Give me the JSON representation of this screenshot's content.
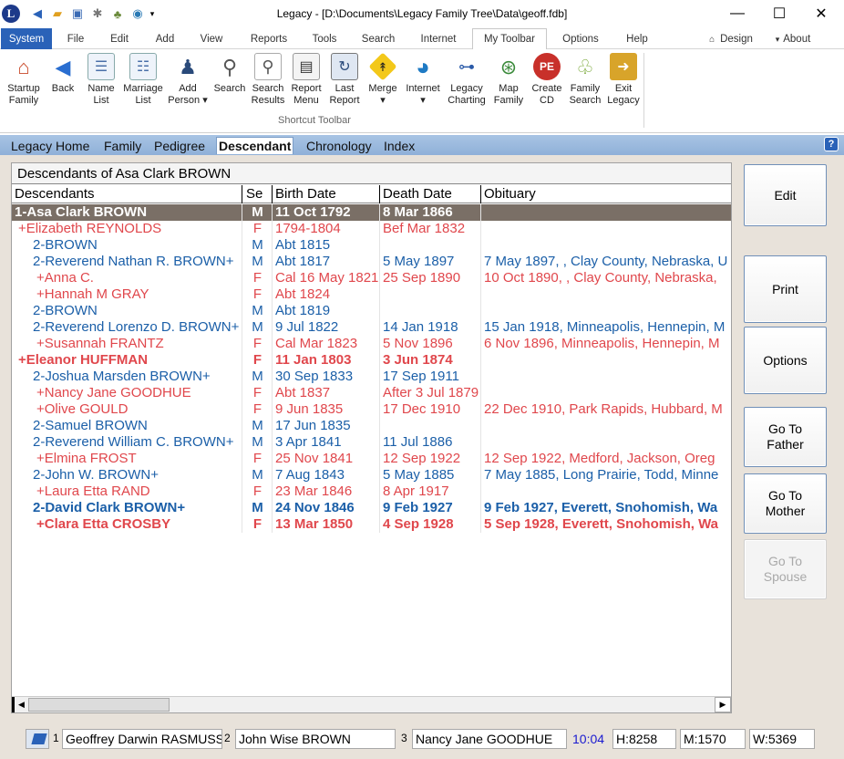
{
  "window": {
    "title": "Legacy - [D:\\Documents\\Legacy Family Tree\\Data\\geoff.fdb]",
    "controls": {
      "minimize": "—",
      "maximize": "☐",
      "close": "✕"
    }
  },
  "quick_access": {
    "logo_letter": "L",
    "icons": [
      "back-arrow-icon",
      "open-folder-icon",
      "save-icon",
      "tools-icon",
      "tree-icon",
      "globe-icon",
      "customize-icon"
    ]
  },
  "menu": {
    "tabs": [
      "System",
      "File",
      "Edit",
      "Add",
      "View",
      "Reports",
      "Tools",
      "Search",
      "Internet",
      "My Toolbar",
      "Options",
      "Help"
    ],
    "active": "My Toolbar",
    "right": {
      "design": "Design",
      "about": "About"
    }
  },
  "ribbon": {
    "group_label": "Shortcut Toolbar",
    "buttons": [
      {
        "l1": "Startup",
        "l2": "Family",
        "icon": "house-icon"
      },
      {
        "l1": "Back",
        "l2": "",
        "icon": "back-arrow-icon"
      },
      {
        "l1": "Name",
        "l2": "List",
        "icon": "name-list-icon"
      },
      {
        "l1": "Marriage",
        "l2": "List",
        "icon": "marriage-list-icon"
      },
      {
        "l1": "Add",
        "l2": "Person ▾",
        "icon": "add-person-icon"
      },
      {
        "l1": "Search",
        "l2": "",
        "icon": "magnifier-icon"
      },
      {
        "l1": "Search",
        "l2": "Results",
        "icon": "search-results-icon"
      },
      {
        "l1": "Report",
        "l2": "Menu",
        "icon": "report-menu-icon"
      },
      {
        "l1": "Last",
        "l2": "Report",
        "icon": "last-report-icon"
      },
      {
        "l1": "Merge",
        "l2": "▾",
        "icon": "merge-sign-icon"
      },
      {
        "l1": "Internet",
        "l2": "▾",
        "icon": "globe-icon"
      },
      {
        "l1": "Legacy",
        "l2": "Charting",
        "icon": "charting-icon"
      },
      {
        "l1": "Map",
        "l2": "Family",
        "icon": "map-icon"
      },
      {
        "l1": "Create",
        "l2": "CD",
        "icon": "cd-icon"
      },
      {
        "l1": "Family",
        "l2": "Search",
        "icon": "family-search-icon"
      },
      {
        "l1": "Exit",
        "l2": "Legacy",
        "icon": "exit-door-icon"
      }
    ]
  },
  "view_tabs": {
    "tabs": [
      "Legacy Home",
      "Family",
      "Pedigree",
      "Descendant",
      "Chronology",
      "Index"
    ],
    "active": "Descendant",
    "help": "?"
  },
  "grid": {
    "title": "Descendants of Asa Clark BROWN",
    "columns": [
      "Descendants",
      "Se",
      "Birth Date",
      "Death Date",
      "Obituary"
    ],
    "rows": [
      {
        "name": "1-Asa Clark BROWN",
        "sex": "M",
        "birth": "11 Oct 1792",
        "death": "8 Mar 1866",
        "obit": "",
        "style": "sel"
      },
      {
        "name": "+Elizabeth REYNOLDS",
        "sex": "F",
        "birth": "1794-1804",
        "death": "Bef Mar 1832",
        "obit": "",
        "style": "f"
      },
      {
        "name": "2-BROWN",
        "sex": "M",
        "birth": "Abt 1815",
        "death": "",
        "obit": "",
        "style": "m"
      },
      {
        "name": "2-Reverend Nathan R. BROWN+",
        "sex": "M",
        "birth": "Abt 1817",
        "death": "5 May 1897",
        "obit": "7 May 1897, , Clay County, Nebraska, U",
        "style": "m"
      },
      {
        "name": "+Anna C.",
        "sex": "F",
        "birth": "Cal 16 May 1821",
        "death": "25 Sep 1890",
        "obit": "10 Oct 1890, , Clay County, Nebraska, ",
        "style": "f"
      },
      {
        "name": "+Hannah M GRAY",
        "sex": "F",
        "birth": "Abt 1824",
        "death": "",
        "obit": "",
        "style": "f"
      },
      {
        "name": "2-BROWN",
        "sex": "M",
        "birth": "Abt 1819",
        "death": "",
        "obit": "",
        "style": "m"
      },
      {
        "name": "2-Reverend Lorenzo D. BROWN+",
        "sex": "M",
        "birth": "9 Jul 1822",
        "death": "14 Jan 1918",
        "obit": "15 Jan 1918, Minneapolis, Hennepin, M",
        "style": "m"
      },
      {
        "name": "+Susannah FRANTZ",
        "sex": "F",
        "birth": "Cal Mar 1823",
        "death": "5 Nov 1896",
        "obit": "6 Nov 1896, Minneapolis, Hennepin, M",
        "style": "f"
      },
      {
        "name": "+Eleanor HUFFMAN",
        "sex": "F",
        "birth": "11 Jan 1803",
        "death": "3 Jun 1874",
        "obit": "",
        "style": "f bold"
      },
      {
        "name": "2-Joshua Marsden BROWN+",
        "sex": "M",
        "birth": "30 Sep 1833",
        "death": "17 Sep 1911",
        "obit": "",
        "style": "m"
      },
      {
        "name": "+Nancy Jane GOODHUE",
        "sex": "F",
        "birth": "Abt 1837",
        "death": "After 3 Jul 1879",
        "obit": "",
        "style": "f"
      },
      {
        "name": "+Olive GOULD",
        "sex": "F",
        "birth": "9 Jun 1835",
        "death": "17 Dec 1910",
        "obit": "22 Dec 1910, Park Rapids, Hubbard, M",
        "style": "f"
      },
      {
        "name": "2-Samuel BROWN",
        "sex": "M",
        "birth": "17 Jun 1835",
        "death": "",
        "obit": "",
        "style": "m"
      },
      {
        "name": "2-Reverend William C. BROWN+",
        "sex": "M",
        "birth": "3 Apr 1841",
        "death": "11 Jul 1886",
        "obit": "",
        "style": "m"
      },
      {
        "name": "+Elmina FROST",
        "sex": "F",
        "birth": "25 Nov 1841",
        "death": "12 Sep 1922",
        "obit": "12 Sep 1922, Medford, Jackson, Oreg",
        "style": "f"
      },
      {
        "name": "2-John W. BROWN+",
        "sex": "M",
        "birth": "7 Aug 1843",
        "death": "5 May 1885",
        "obit": "7 May 1885, Long Prairie, Todd, Minne",
        "style": "m"
      },
      {
        "name": "+Laura Etta RAND",
        "sex": "F",
        "birth": "23 Mar 1846",
        "death": "8 Apr 1917",
        "obit": "",
        "style": "f"
      },
      {
        "name": "2-David Clark BROWN+",
        "sex": "M",
        "birth": "24 Nov 1846",
        "death": "9 Feb 1927",
        "obit": "9 Feb 1927, Everett, Snohomish, Wa",
        "style": "m bold"
      },
      {
        "name": "+Clara Etta CROSBY",
        "sex": "F",
        "birth": "13 Mar 1850",
        "death": "4 Sep 1928",
        "obit": "5 Sep 1928, Everett, Snohomish, Wa",
        "style": "f bold"
      }
    ]
  },
  "side_buttons": {
    "edit": "Edit",
    "print": "Print",
    "options": "Options",
    "go_father_1": "Go To",
    "go_father_2": "Father",
    "go_mother_1": "Go To",
    "go_mother_2": "Mother",
    "go_spouse_1": "Go To",
    "go_spouse_2": "Spouse"
  },
  "statusbar": {
    "n1": "1",
    "person1": "Geoffrey Darwin RASMUSSEN",
    "n2": "2",
    "person2": "John Wise BROWN",
    "n3": "3",
    "person3": "Nancy Jane GOODHUE",
    "time": "10:04",
    "h": "H:8258",
    "m": "M:1570",
    "w": "W:5369"
  },
  "colors": {
    "male": "#1b5fa8",
    "female": "#e0474c",
    "selected_row": "#7a6f66",
    "accent": "#2a62b8"
  }
}
